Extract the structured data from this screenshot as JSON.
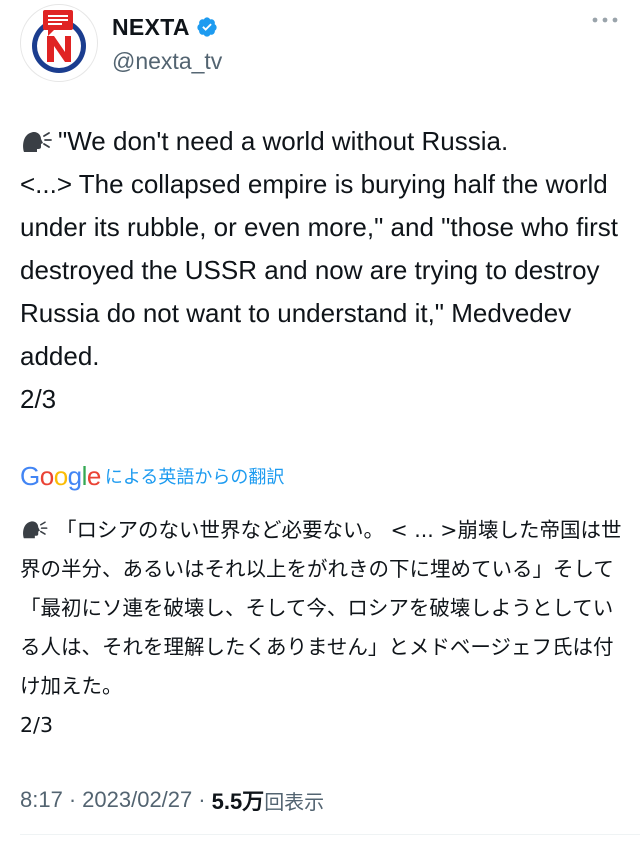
{
  "author": {
    "display_name": "NEXTA",
    "handle": "@nexta_tv",
    "verified": true,
    "avatar_icon": "nexta-logo-icon"
  },
  "tweet": {
    "speaker_icon": "speaking-head-icon",
    "text": "\"We don't need a world without Russia.\n<...> The collapsed empire is burying half the world under its rubble, or even more,\" and \"those who first destroyed the USSR and now are trying to destroy Russia do not want to understand it,\" Medvedev added.\n2/3"
  },
  "translation": {
    "provider": "Google",
    "label": "による英語からの翻訳",
    "text": "「ロシアのない世界など必要ない。 < ... >崩壊した帝国は世界の半分、あるいはそれ以上をがれきの下に埋めている」そして「最初にソ連を破壊し、そして今、ロシアを破壊しようとしている人は、それを理解したくありません」とメドベージェフ氏は付け加えた。\n2/3"
  },
  "meta": {
    "time": "8:17",
    "separator": "·",
    "date": "2023/02/27",
    "views_count": "5.5万",
    "views_label": "回表示"
  },
  "colors": {
    "text": "#0f1419",
    "secondary": "#536471",
    "link": "#1d9bf0",
    "verified": "#1d9bf0",
    "avatar_red": "#e02323",
    "avatar_blue": "#1b3d8f"
  }
}
